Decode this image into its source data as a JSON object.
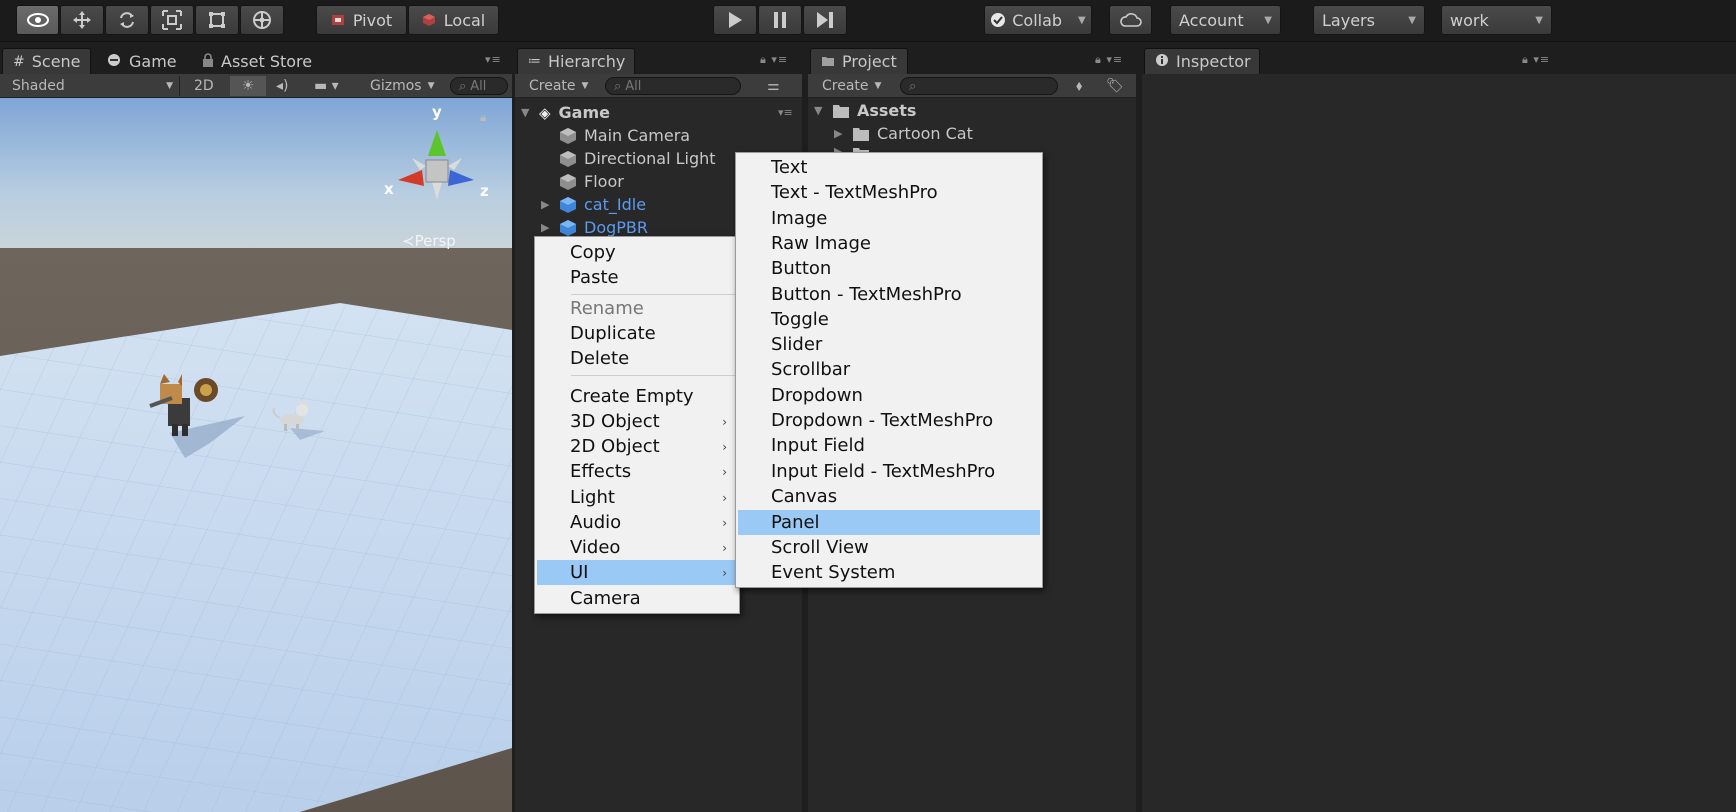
{
  "toolbar": {
    "pivot_label": "Pivot",
    "local_label": "Local",
    "collab_label": "Collab",
    "account_label": "Account",
    "layers_label": "Layers",
    "layout_label": "work"
  },
  "scene_panel": {
    "tabs": [
      {
        "label": "Scene"
      },
      {
        "label": "Game"
      },
      {
        "label": "Asset Store"
      }
    ],
    "shading_mode": "Shaded",
    "mode_2d_label": "2D",
    "gizmos_label": "Gizmos",
    "search_placeholder": "All",
    "gizmo": {
      "x_label": "x",
      "y_label": "y",
      "z_label": "z",
      "persp_label": "Persp"
    }
  },
  "hierarchy_panel": {
    "tab_label": "Hierarchy",
    "create_label": "Create",
    "search_placeholder": "All",
    "scene_name": "Game",
    "items": [
      {
        "label": "Main Camera",
        "prefab": false,
        "expandable": false
      },
      {
        "label": "Directional Light",
        "prefab": false,
        "expandable": false
      },
      {
        "label": "Floor",
        "prefab": false,
        "expandable": false
      },
      {
        "label": "cat_Idle",
        "prefab": true,
        "expandable": true
      },
      {
        "label": "DogPBR",
        "prefab": true,
        "expandable": true
      }
    ]
  },
  "project_panel": {
    "tab_label": "Project",
    "create_label": "Create",
    "root_folder": "Assets",
    "folders": [
      {
        "label": "Cartoon Cat"
      }
    ]
  },
  "inspector_panel": {
    "tab_label": "Inspector"
  },
  "context_menu": {
    "groups": [
      [
        {
          "label": "Copy",
          "enabled": true
        },
        {
          "label": "Paste",
          "enabled": true
        }
      ],
      [
        {
          "label": "Rename",
          "enabled": false
        },
        {
          "label": "Duplicate",
          "enabled": true
        },
        {
          "label": "Delete",
          "enabled": true
        }
      ],
      [
        {
          "label": "Create Empty",
          "submenu": false
        },
        {
          "label": "3D Object",
          "submenu": true
        },
        {
          "label": "2D Object",
          "submenu": true
        },
        {
          "label": "Effects",
          "submenu": true
        },
        {
          "label": "Light",
          "submenu": true
        },
        {
          "label": "Audio",
          "submenu": true
        },
        {
          "label": "Video",
          "submenu": true
        },
        {
          "label": "UI",
          "submenu": true,
          "highlighted": true
        },
        {
          "label": "Camera",
          "submenu": false
        }
      ]
    ]
  },
  "ui_submenu": {
    "items": [
      {
        "label": "Text"
      },
      {
        "label": "Text - TextMeshPro"
      },
      {
        "label": "Image"
      },
      {
        "label": "Raw Image"
      },
      {
        "label": "Button"
      },
      {
        "label": "Button - TextMeshPro"
      },
      {
        "label": "Toggle"
      },
      {
        "label": "Slider"
      },
      {
        "label": "Scrollbar"
      },
      {
        "label": "Dropdown"
      },
      {
        "label": "Dropdown - TextMeshPro"
      },
      {
        "label": "Input Field"
      },
      {
        "label": "Input Field - TextMeshPro"
      },
      {
        "label": "Canvas"
      },
      {
        "label": "Panel",
        "highlighted": true
      },
      {
        "label": "Scroll View"
      },
      {
        "label": "Event System"
      }
    ]
  },
  "colors": {
    "menu_highlight": "#99c9f4",
    "prefab_text": "#5c9bf0",
    "panel_bg": "#282828"
  }
}
